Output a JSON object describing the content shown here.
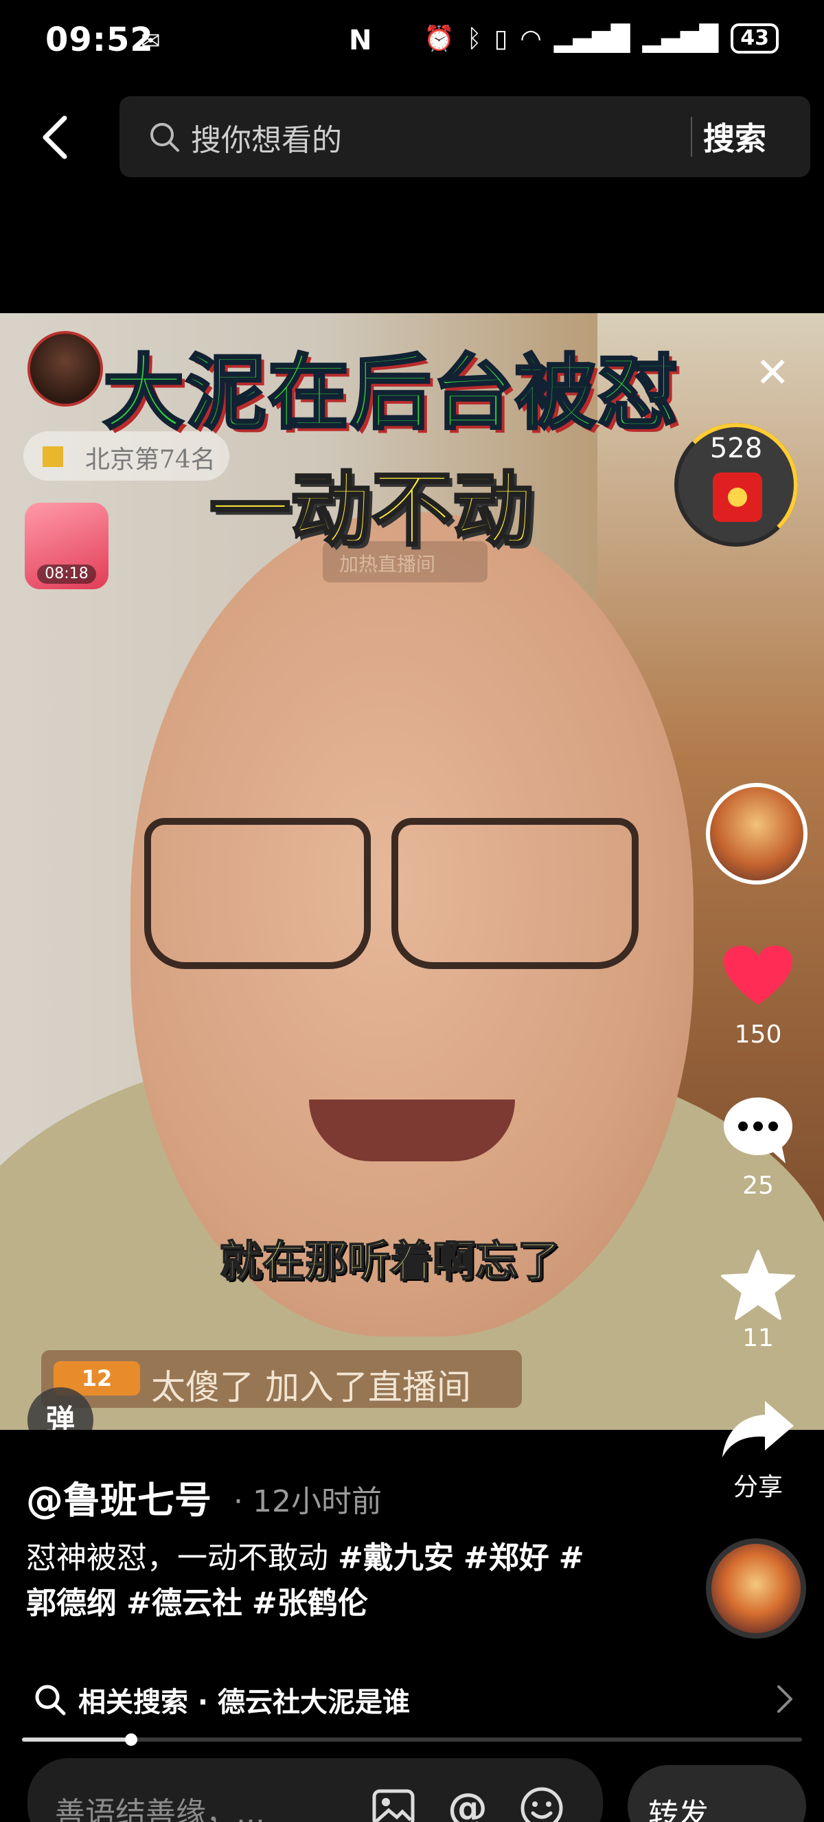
{
  "status_bar": {
    "time": "09:52",
    "mail_glyph": "✉",
    "nfc": "N",
    "battery": "43"
  },
  "search": {
    "placeholder": "搜你想看的",
    "button_label": "搜索"
  },
  "video": {
    "overlay_title": "大泥在后台被怼",
    "overlay_subtitle": "一动不动",
    "rank_badge": "北京第74名",
    "mini_card_time": "08:18",
    "ghost_badge": "加热直播间",
    "redpacket_count": "528",
    "caption": "就在那听着啊忘了",
    "join_level": "12",
    "join_text": "太傻了 加入了直播间",
    "danmu_label": "弹"
  },
  "rail": {
    "like_count": "150",
    "comment_count": "25",
    "favorite_count": "11",
    "share_label": "分享"
  },
  "post": {
    "author": "@鲁班七号",
    "time": "· 12小时前",
    "desc_text": "怼神被怼，一动不敢动 ",
    "tags": [
      "#戴九安",
      "#郑好",
      "#",
      "郭德纲",
      "#德云社",
      "#张鹤伦"
    ]
  },
  "related": {
    "label": "相关搜索 · 德云社大泥是谁"
  },
  "progress": {
    "fraction": 0.14
  },
  "comment": {
    "placeholder": "善语结善缘，...",
    "send_label": "转发"
  },
  "colors": {
    "title_green": "#34d63a",
    "subtitle_yellow": "#ffec3a",
    "heart_red": "#ff2d55",
    "background": "#000000"
  },
  "icons": [
    "back-icon",
    "search-icon",
    "close-icon",
    "red-packet-icon",
    "heart-icon",
    "comment-icon",
    "star-icon",
    "share-icon",
    "image-icon",
    "mention-icon",
    "emoji-icon",
    "chevron-right-icon"
  ]
}
